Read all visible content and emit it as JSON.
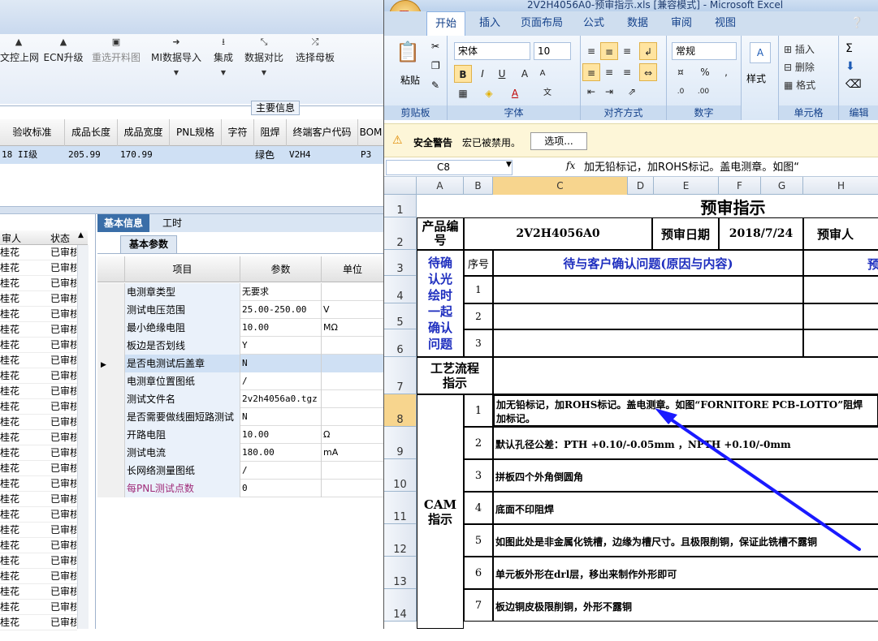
{
  "left_app": {
    "toolbar": [
      {
        "label": "文控上网",
        "icon": "upload-icon",
        "disabled": false
      },
      {
        "label": "ECN升级",
        "icon": "upgrade-icon",
        "disabled": false
      },
      {
        "label": "重选开料图",
        "icon": "image-icon",
        "disabled": true
      },
      {
        "label": "MI数据导入",
        "icon": "import-icon",
        "disabled": false
      },
      {
        "label": "集成",
        "icon": "download-icon",
        "disabled": false
      },
      {
        "label": "数据对比",
        "icon": "compare-icon",
        "disabled": false
      },
      {
        "label": "选择母板",
        "icon": "shuffle-icon",
        "disabled": false
      }
    ],
    "section_title": "主要信息",
    "grid_headers": [
      "验收标准",
      "成品长度",
      "成品宽度",
      "PNL规格",
      "字符",
      "阻焊",
      "终端客户代码",
      "BOM"
    ],
    "grid_row": [
      "18 II级",
      "205.99",
      "170.99",
      "",
      "",
      "绿色",
      "V2H4",
      "P3"
    ],
    "side_list": {
      "headers": [
        "审人",
        "状态"
      ],
      "rows": [
        [
          "桂花",
          "已审核"
        ],
        [
          "桂花",
          "已审核"
        ],
        [
          "桂花",
          "已审核"
        ],
        [
          "桂花",
          "已审核"
        ],
        [
          "桂花",
          "已审核"
        ],
        [
          "桂花",
          "已审核"
        ],
        [
          "桂花",
          "已审核"
        ],
        [
          "桂花",
          "已审核"
        ],
        [
          "桂花",
          "已审核"
        ],
        [
          "桂花",
          "已审核"
        ],
        [
          "桂花",
          "已审核"
        ],
        [
          "桂花",
          "已审核"
        ],
        [
          "桂花",
          "已审核"
        ],
        [
          "桂花",
          "已审核"
        ],
        [
          "桂花",
          "已审核"
        ],
        [
          "桂花",
          "已审核"
        ],
        [
          "桂花",
          "已审核"
        ],
        [
          "桂花",
          "已审核"
        ],
        [
          "桂花",
          "已审核"
        ],
        [
          "桂花",
          "已审核"
        ],
        [
          "桂花",
          "已审核"
        ],
        [
          "桂花",
          "已审核"
        ],
        [
          "桂花",
          "已审核"
        ],
        [
          "桂花",
          "已审核"
        ],
        [
          "桂花",
          "已审核"
        ]
      ]
    },
    "tabs": [
      "基本信息",
      "工时"
    ],
    "subtab": "基本参数",
    "param_headers": [
      "项目",
      "参数",
      "单位"
    ],
    "params": [
      {
        "k": "电测章类型",
        "v": "无要求",
        "u": ""
      },
      {
        "k": "测试电压范围",
        "v": "25.00-250.00",
        "u": "V"
      },
      {
        "k": "最小绝缘电阻",
        "v": "10.00",
        "u": "MΩ"
      },
      {
        "k": "板边是否划线",
        "v": "Y",
        "u": ""
      },
      {
        "k": "是否电测试后盖章",
        "v": "N",
        "u": ""
      },
      {
        "k": "电测章位置图纸",
        "v": "/",
        "u": ""
      },
      {
        "k": "测试文件名",
        "v": "2v2h4056a0.tgz",
        "u": ""
      },
      {
        "k": "是否需要做线圈短路测试",
        "v": "N",
        "u": ""
      },
      {
        "k": "开路电阻",
        "v": "10.00",
        "u": "Ω"
      },
      {
        "k": "测试电流",
        "v": "180.00",
        "u": "mA"
      },
      {
        "k": "长网络测量图纸",
        "v": "/",
        "u": ""
      },
      {
        "k": "每PNL测试点数",
        "v": "0",
        "u": ""
      }
    ]
  },
  "excel": {
    "title": "2V2H4056A0-预审指示.xls  [兼容模式] - Microsoft Excel",
    "tabs": [
      "开始",
      "插入",
      "页面布局",
      "公式",
      "数据",
      "审阅",
      "视图"
    ],
    "groups": [
      "剪贴板",
      "字体",
      "对齐方式",
      "数字",
      "样式",
      "单元格",
      "编辑"
    ],
    "paste_label": "粘贴",
    "font_name": "宋体",
    "font_size": "10",
    "number_format": "常规",
    "style_label": "样式",
    "cell_insert": "插入",
    "cell_delete": "删除",
    "cell_format": "格式",
    "security_title": "安全警告",
    "security_msg": "宏已被禁用。",
    "options_btn": "选项...",
    "name_box": "C8",
    "formula": "加无铅标记，加ROHS标记。盖电测章。如图“",
    "columns": [
      "A",
      "B",
      "C",
      "D",
      "E",
      "F",
      "G",
      "H"
    ],
    "rows": [
      "1",
      "2",
      "3",
      "4",
      "5",
      "6",
      "7",
      "8",
      "9",
      "10",
      "11",
      "12",
      "13",
      "14"
    ],
    "sheet": {
      "title": "预审指示",
      "product_label": "产品编号",
      "product_value": "2V2H4056A0",
      "date_label": "预审日期",
      "date_value": "2018/7/24",
      "reviewer_label": "预审人",
      "seq_label": "序号",
      "question_header": "待与客户确认问题(原因与内容)",
      "right_header_partial": "预",
      "confirm_label": "待确认光绘时一起确认问题",
      "confirm_nums": [
        "1",
        "2",
        "3"
      ],
      "process_label": "工艺流程指示",
      "cam_label": "CAM指示",
      "instructions": [
        {
          "n": "1",
          "text": "加无铅标记，加ROHS标记。盖电测章。如图“FORNITORE PCB-LOTTO”阻焊",
          "text2": "加标记。"
        },
        {
          "n": "2",
          "text": "默认孔径公差：PTH +0.10/-0.05mm ，NPTH +0.10/-0mm"
        },
        {
          "n": "3",
          "text": "拼板四个外角倒圆角"
        },
        {
          "n": "4",
          "text": "底面不印阻焊"
        },
        {
          "n": "5",
          "text": "如图此处是非金属化铣槽，边缘为槽尺寸。且极限削铜，保证此铣槽不露铜"
        },
        {
          "n": "6",
          "text": "单元板外形在drl层，移出来制作外形即可"
        },
        {
          "n": "7",
          "text": "板边铜皮极限削铜，外形不露铜"
        }
      ]
    }
  },
  "annotation_color": "#1a1aff"
}
